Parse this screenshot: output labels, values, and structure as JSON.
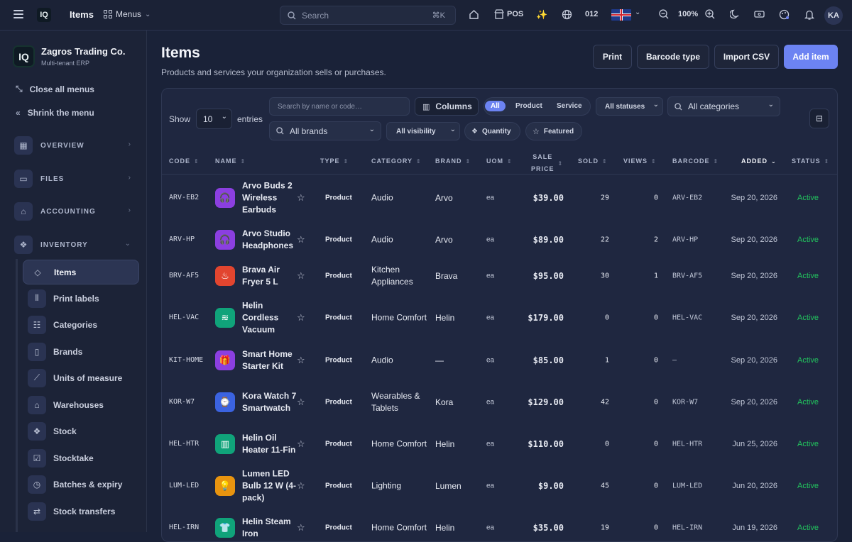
{
  "topbar": {
    "title": "Items",
    "menus": "Menus",
    "search_placeholder": "Search",
    "shortcut": "⌘K",
    "pos": "POS",
    "year": "012",
    "zoom": "100%",
    "avatar": "KA"
  },
  "sidebar": {
    "org_name": "Zagros Trading Co.",
    "org_sub": "Multi-tenant ERP",
    "close_all": "Close all menus",
    "shrink": "Shrink the menu",
    "sections": [
      {
        "label": "OVERVIEW"
      },
      {
        "label": "FILES"
      },
      {
        "label": "ACCOUNTING"
      },
      {
        "label": "INVENTORY"
      }
    ],
    "items": [
      {
        "label": "Items"
      },
      {
        "label": "Print labels"
      },
      {
        "label": "Categories"
      },
      {
        "label": "Brands"
      },
      {
        "label": "Units of measure"
      },
      {
        "label": "Warehouses"
      },
      {
        "label": "Stock"
      },
      {
        "label": "Stocktake"
      },
      {
        "label": "Batches & expiry"
      },
      {
        "label": "Stock transfers"
      }
    ]
  },
  "header": {
    "title": "Items",
    "subtitle": "Products and services your organization sells or purchases.",
    "print": "Print",
    "barcode_type": "Barcode type",
    "import_csv": "Import CSV",
    "add_item": "Add item"
  },
  "controls": {
    "show": "Show",
    "entries_value": "10",
    "entries": "entries",
    "search_placeholder": "Search by name or code…",
    "columns": "Columns",
    "seg_all": "All",
    "seg_product": "Product",
    "seg_service": "Service",
    "statuses": "All statuses",
    "categories": "All categories",
    "brands": "All brands",
    "visibility": "All visibility",
    "quantity": "Quantity",
    "featured": "Featured"
  },
  "columns": {
    "code": "CODE",
    "name": "NAME",
    "type": "TYPE",
    "category": "CATEGORY",
    "brand": "BRAND",
    "uom": "UOM",
    "sale": "SALE",
    "price": "PRICE",
    "sold": "SOLD",
    "views": "VIEWS",
    "barcode": "BARCODE",
    "added": "ADDED",
    "status": "STATUS"
  },
  "rows": [
    {
      "code": "ARV-EB2",
      "name": "Arvo Buds 2 Wireless Earbuds",
      "type": "Product",
      "category": "Audio",
      "brand": "Arvo",
      "uom": "ea",
      "price": "$39.00",
      "sold": "29",
      "views": "0",
      "barcode": "ARV-EB2",
      "added": "Sep 20, 2026",
      "status": "Active",
      "icon": "headphones-icon",
      "color": "#8b3fe0"
    },
    {
      "code": "ARV-HP",
      "name": "Arvo Studio Headphones",
      "type": "Product",
      "category": "Audio",
      "brand": "Arvo",
      "uom": "ea",
      "price": "$89.00",
      "sold": "22",
      "views": "2",
      "barcode": "ARV-HP",
      "added": "Sep 20, 2026",
      "status": "Active",
      "icon": "headphones-icon",
      "color": "#8b3fe0"
    },
    {
      "code": "BRV-AF5",
      "name": "Brava Air Fryer 5 L",
      "type": "Product",
      "category": "Kitchen Appliances",
      "brand": "Brava",
      "uom": "ea",
      "price": "$95.00",
      "sold": "30",
      "views": "1",
      "barcode": "BRV-AF5",
      "added": "Sep 20, 2026",
      "status": "Active",
      "icon": "chef-hat-icon",
      "color": "#e2452f"
    },
    {
      "code": "HEL-VAC",
      "name": "Helin Cordless Vacuum",
      "type": "Product",
      "category": "Home Comfort",
      "brand": "Helin",
      "uom": "ea",
      "price": "$179.00",
      "sold": "0",
      "views": "0",
      "barcode": "HEL-VAC",
      "added": "Sep 20, 2026",
      "status": "Active",
      "icon": "wind-icon",
      "color": "#10a37a"
    },
    {
      "code": "KIT-HOME",
      "name": "Smart Home Starter Kit",
      "type": "Product",
      "category": "Audio",
      "brand": "—",
      "uom": "ea",
      "price": "$85.00",
      "sold": "1",
      "views": "0",
      "barcode": "—",
      "added": "Sep 20, 2026",
      "status": "Active",
      "icon": "gift-icon",
      "color": "#8b3fe0"
    },
    {
      "code": "KOR-W7",
      "name": "Kora Watch 7 Smartwatch",
      "type": "Product",
      "category": "Wearables & Tablets",
      "brand": "Kora",
      "uom": "ea",
      "price": "$129.00",
      "sold": "42",
      "views": "0",
      "barcode": "KOR-W7",
      "added": "Sep 20, 2026",
      "status": "Active",
      "icon": "watch-icon",
      "color": "#3b63e0"
    },
    {
      "code": "HEL-HTR",
      "name": "Helin Oil Heater 11-Fin",
      "type": "Product",
      "category": "Home Comfort",
      "brand": "Helin",
      "uom": "ea",
      "price": "$110.00",
      "sold": "0",
      "views": "0",
      "barcode": "HEL-HTR",
      "added": "Jun 25, 2026",
      "status": "Active",
      "icon": "heater-icon",
      "color": "#10a37a"
    },
    {
      "code": "LUM-LED",
      "name": "Lumen LED Bulb 12 W (4-pack)",
      "type": "Product",
      "category": "Lighting",
      "brand": "Lumen",
      "uom": "ea",
      "price": "$9.00",
      "sold": "45",
      "views": "0",
      "barcode": "LUM-LED",
      "added": "Jun 20, 2026",
      "status": "Active",
      "icon": "lightbulb-icon",
      "color": "#e8940f"
    },
    {
      "code": "HEL-IRN",
      "name": "Helin Steam Iron",
      "type": "Product",
      "category": "Home Comfort",
      "brand": "Helin",
      "uom": "ea",
      "price": "$35.00",
      "sold": "19",
      "views": "0",
      "barcode": "HEL-IRN",
      "added": "Jun 19, 2026",
      "status": "Active",
      "icon": "shirt-icon",
      "color": "#10a37a"
    }
  ]
}
